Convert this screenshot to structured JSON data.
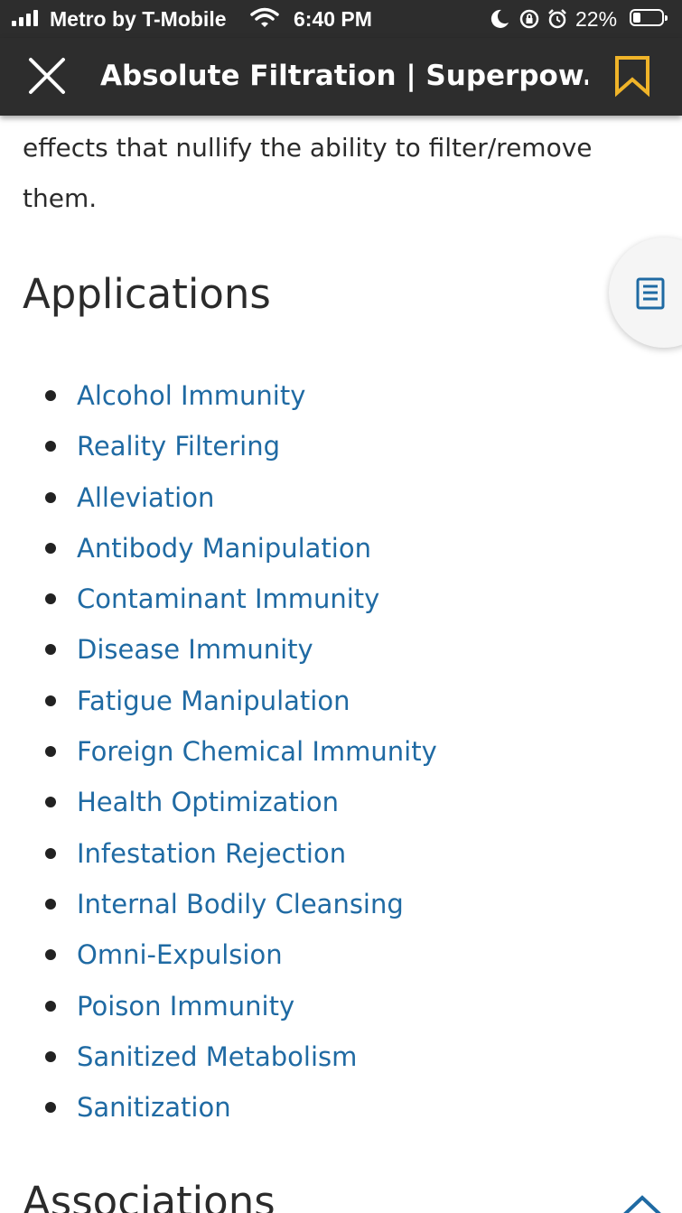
{
  "status_bar": {
    "carrier": "Metro by T-Mobile",
    "time": "6:40 PM",
    "battery": "22%",
    "battery_level": 0.22,
    "icons": [
      "signal-icon",
      "wifi-icon",
      "moon-icon",
      "orientation-lock-icon",
      "alarm-icon",
      "battery-icon"
    ]
  },
  "header": {
    "title": "Absolute Filtration | Superpow...",
    "close_icon": "close-icon",
    "bookmark_icon": "bookmark-icon"
  },
  "colors": {
    "header_bg": "#2d2d2d",
    "link": "#1f6aa3",
    "bookmark": "#f0b429",
    "text": "#2b2b2b"
  },
  "article": {
    "intro_text": "effects that nullify the ability to filter/remove them.",
    "applications_heading": "Applications",
    "applications": [
      "Alcohol Immunity",
      "Reality Filtering",
      "Alleviation",
      "Antibody Manipulation",
      "Contaminant Immunity",
      "Disease Immunity",
      "Fatigue Manipulation",
      "Foreign Chemical Immunity",
      "Health Optimization",
      "Infestation Rejection",
      "Internal Bodily Cleansing",
      "Omni-Expulsion",
      "Poison Immunity",
      "Sanitized Metabolism",
      "Sanitization"
    ],
    "associations_heading": "Associations"
  }
}
